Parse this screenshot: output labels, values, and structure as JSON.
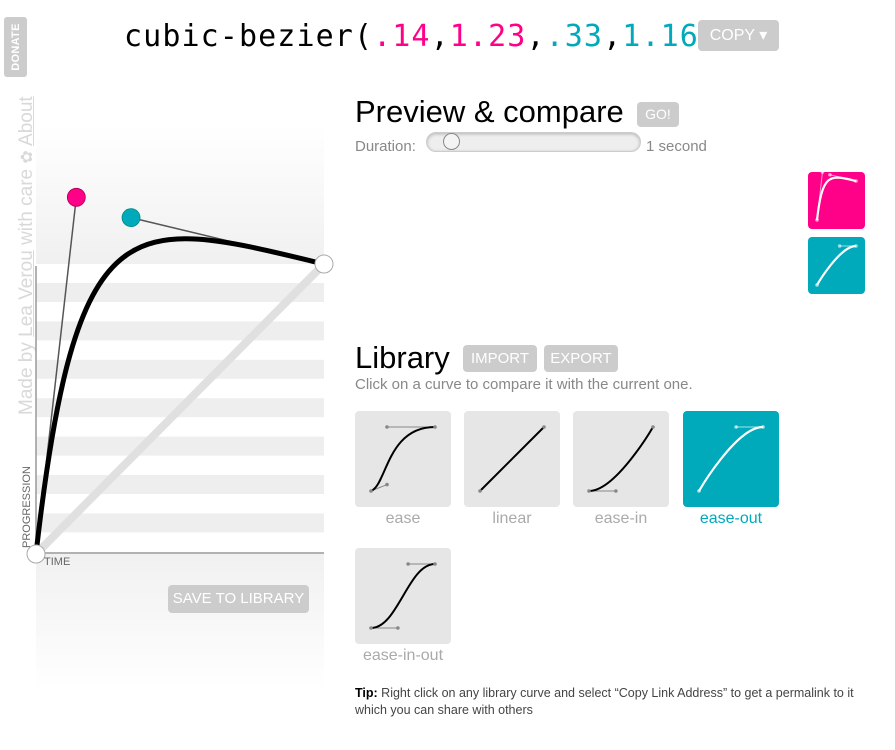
{
  "sidebar": {
    "donate_label": "DONATE",
    "credits_prefix": "Made by ",
    "author_link": "Lea Verou",
    "credits_middle": " with care ",
    "flower_icon": "✿",
    "about_link": "About"
  },
  "header": {
    "fn_name": "cubic-bezier(",
    "p1x": ".14",
    "p1y": "1.23",
    "p2x": ".33",
    "p2y": "1.16",
    "sep": ",",
    "close": ")",
    "copy_label": "COPY ▾"
  },
  "editor": {
    "curve": {
      "x1": 0.14,
      "y1": 1.23,
      "x2": 0.33,
      "y2": 1.16
    },
    "y_axis_label": "PROGRESSION",
    "x_axis_label": "TIME",
    "save_label": "SAVE TO LIBRARY",
    "colors": {
      "p1": "#ff0088",
      "p2": "#00aabb"
    }
  },
  "preview": {
    "title": "Preview & compare",
    "go_label": "GO!",
    "duration_label": "Duration:",
    "duration_value": "1 second",
    "duration_seconds": 1,
    "current_curve": {
      "x1": 0.14,
      "y1": 1.23,
      "x2": 0.33,
      "y2": 1.16
    },
    "compare_curve": {
      "x1": 0,
      "y1": 0,
      "x2": 0.58,
      "y2": 1
    }
  },
  "library": {
    "title": "Library",
    "import_label": "IMPORT",
    "export_label": "EXPORT",
    "hint": "Click on a curve to compare it with the current one.",
    "items": [
      {
        "name": "ease",
        "x1": 0.25,
        "y1": 0.1,
        "x2": 0.25,
        "y2": 1,
        "active": false
      },
      {
        "name": "linear",
        "x1": 0,
        "y1": 0,
        "x2": 1,
        "y2": 1,
        "active": false
      },
      {
        "name": "ease-in",
        "x1": 0.42,
        "y1": 0,
        "x2": 1,
        "y2": 1,
        "active": false
      },
      {
        "name": "ease-out",
        "x1": 0,
        "y1": 0,
        "x2": 0.58,
        "y2": 1,
        "active": true
      },
      {
        "name": "ease-in-out",
        "x1": 0.42,
        "y1": 0,
        "x2": 0.58,
        "y2": 1,
        "active": false
      }
    ]
  },
  "tip": {
    "label": "Tip:",
    "text": " Right click on any library curve and select “Copy Link Address” to get a permalink to it which you can share with others"
  }
}
